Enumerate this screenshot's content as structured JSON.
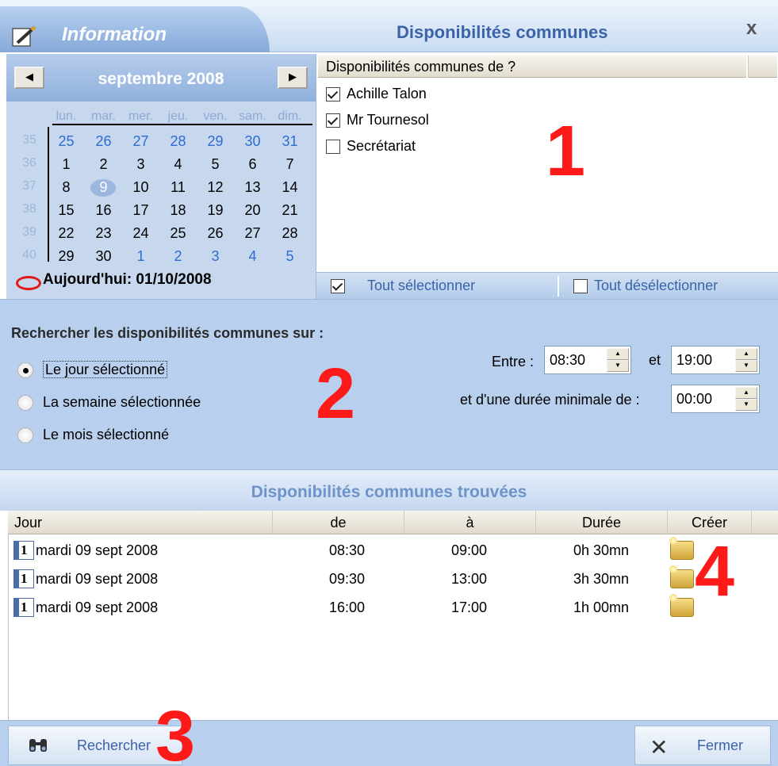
{
  "window": {
    "tab_label": "Information",
    "title": "Disponibilités communes",
    "close_glyph": "x"
  },
  "calendar": {
    "month_label": "septembre 2008",
    "prev_glyph": "◀",
    "next_glyph": "▶",
    "days_of_week": [
      "lun.",
      "mar.",
      "mer.",
      "jeu.",
      "ven.",
      "sam.",
      "dim."
    ],
    "weeks": [
      {
        "num": "35",
        "days": [
          "25",
          "26",
          "27",
          "28",
          "29",
          "30",
          "31"
        ]
      },
      {
        "num": "36",
        "days": [
          "1",
          "2",
          "3",
          "4",
          "5",
          "6",
          "7"
        ]
      },
      {
        "num": "37",
        "days": [
          "8",
          "9",
          "10",
          "11",
          "12",
          "13",
          "14"
        ]
      },
      {
        "num": "38",
        "days": [
          "15",
          "16",
          "17",
          "18",
          "19",
          "20",
          "21"
        ]
      },
      {
        "num": "39",
        "days": [
          "22",
          "23",
          "24",
          "25",
          "26",
          "27",
          "28"
        ]
      },
      {
        "num": "40",
        "days": [
          "29",
          "30",
          "1",
          "2",
          "3",
          "4",
          "5"
        ]
      }
    ],
    "selected_day": "9",
    "today_label": "Aujourd'hui: 01/10/2008"
  },
  "participants": {
    "header": "Disponibilités communes de ?",
    "items": [
      {
        "label": "Achille Talon",
        "checked": true
      },
      {
        "label": "Mr Tournesol",
        "checked": true
      },
      {
        "label": "Secrétariat",
        "checked": false
      }
    ],
    "select_all": "Tout sélectionner",
    "deselect_all": "Tout désélectionner"
  },
  "search": {
    "title": "Rechercher les disponibilités communes sur :",
    "options": [
      {
        "label": "Le jour sélectionné",
        "selected": true
      },
      {
        "label": "La semaine sélectionnée",
        "selected": false
      },
      {
        "label": "Le mois sélectionné",
        "selected": false
      }
    ],
    "between_label": "Entre :",
    "start_time": "08:30",
    "and_label": "et",
    "end_time": "19:00",
    "min_duration_label": "et d'une durée minimale de :",
    "min_duration": "00:00"
  },
  "results": {
    "title": "Disponibilités communes trouvées",
    "columns": [
      "Jour",
      "de",
      "à",
      "Durée",
      "Créer"
    ],
    "rows": [
      {
        "day": "mardi 09 sept 2008",
        "from": "08:30",
        "to": "09:00",
        "duration": "0h 30mn"
      },
      {
        "day": "mardi 09 sept 2008",
        "from": "09:30",
        "to": "13:00",
        "duration": "3h 30mn"
      },
      {
        "day": "mardi 09 sept 2008",
        "from": "16:00",
        "to": "17:00",
        "duration": "1h 00mn"
      }
    ],
    "calendar_icon_digit": "1"
  },
  "buttons": {
    "search": "Rechercher",
    "close": "Fermer"
  },
  "annotations": [
    "1",
    "2",
    "3",
    "4"
  ],
  "colors": {
    "accent": "#3b63a8",
    "annotation": "#ff1a1a",
    "panel": "#b8cfed"
  }
}
